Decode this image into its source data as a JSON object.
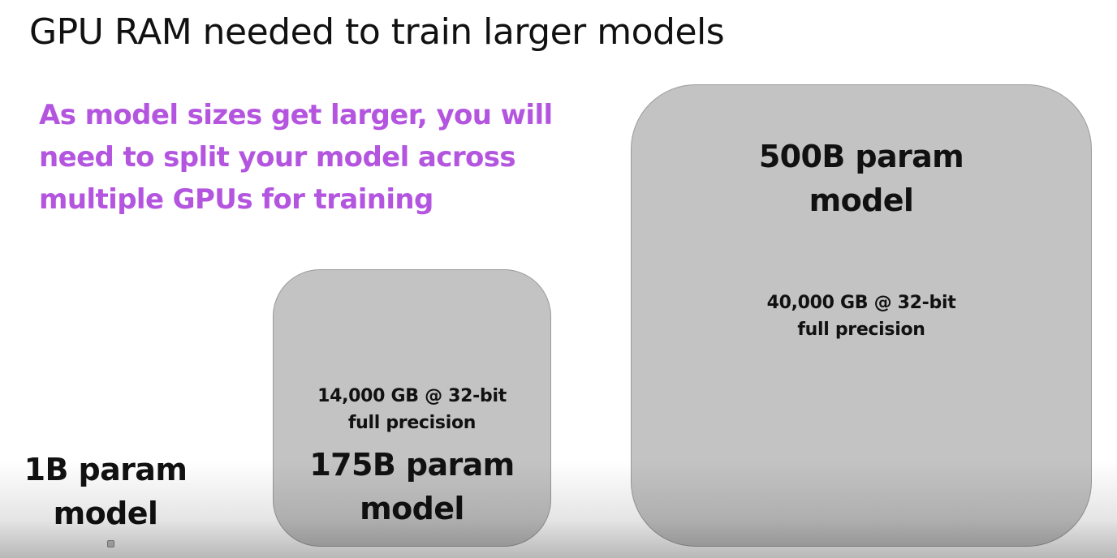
{
  "slide": {
    "title": "GPU RAM needed to train larger models",
    "subtitle": [
      "As model sizes get larger, you will",
      "need to split your model across",
      "multiple GPUs for training"
    ]
  },
  "models": {
    "small": {
      "label": [
        "1B param",
        "model"
      ]
    },
    "medium": {
      "label": [
        "175B param",
        "model"
      ],
      "memory": [
        "14,000 GB @ 32-bit",
        "full precision"
      ]
    },
    "large": {
      "label": [
        "500B param",
        "model"
      ],
      "memory": [
        "40,000 GB @ 32-bit",
        "full precision"
      ]
    }
  },
  "colors": {
    "accent": "#b455e0",
    "box_fill": "#c3c3c3",
    "text": "#111111"
  }
}
